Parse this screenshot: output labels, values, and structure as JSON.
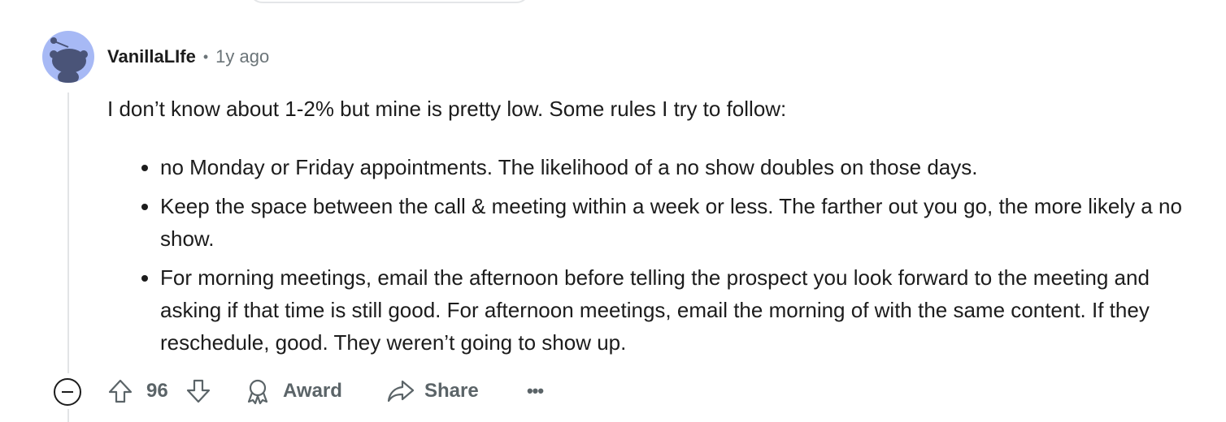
{
  "comment": {
    "author": "VanillaLIfe",
    "separator": "•",
    "time": "1y ago",
    "intro": "I don’t know about 1-2% but mine is pretty low. Some rules I try to follow:",
    "rules": [
      "no Monday or Friday appointments. The likelihood of a no show doubles on those days.",
      "Keep the space between the call & meeting within a week or less. The farther out you go, the more likely a no show.",
      "For morning meetings, email the afternoon before telling the prospect you look forward to the meeting and asking if that time is still good. For afternoon meetings, email the morning of with the same content. If they reschedule, good. They weren’t going to show up."
    ]
  },
  "actions": {
    "collapse_icon": "minus-circle-icon",
    "upvote_icon": "arrow-up-icon",
    "vote_count": "96",
    "downvote_icon": "arrow-down-icon",
    "award_label": "Award",
    "award_icon": "award-icon",
    "share_label": "Share",
    "share_icon": "share-icon",
    "more_label": "•••"
  },
  "colors": {
    "avatar_bg": "#a7b9f5",
    "meta_gray": "#6b7478",
    "action_gray": "#5b6468",
    "thread_line": "#e2e4e6"
  }
}
